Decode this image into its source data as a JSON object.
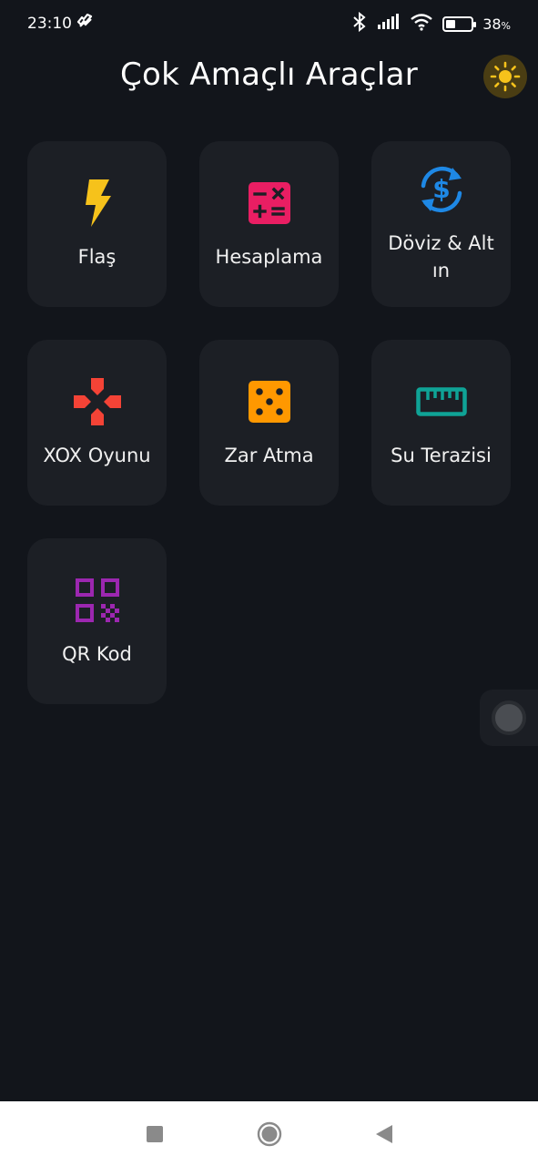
{
  "status_bar": {
    "time": "23:10",
    "battery_percent": "38",
    "battery_percent_suffix": "%",
    "battery_level": 0.38,
    "icons": [
      "notification-icon",
      "bluetooth-icon",
      "signal-icon",
      "wifi-icon",
      "battery-icon"
    ]
  },
  "header": {
    "title": "Çok Amaçlı Araçlar",
    "theme_toggle_icon": "sun-icon"
  },
  "tools": [
    {
      "label": "Flaş",
      "icon": "flash-icon",
      "color": "#f6c21b"
    },
    {
      "label": "Hesaplama",
      "icon": "calculator-icon",
      "color": "#e91e63"
    },
    {
      "label": "Döviz & Altın",
      "icon": "currency-exchange-icon",
      "color": "#1e88e5"
    },
    {
      "label": "XOX Oyunu",
      "icon": "gamepad-icon",
      "color": "#f44336"
    },
    {
      "label": "Zar Atma",
      "icon": "dice-icon",
      "color": "#ff9800"
    },
    {
      "label": "Su Terazisi",
      "icon": "ruler-icon",
      "color": "#0fa396"
    },
    {
      "label": "QR Kod",
      "icon": "qr-code-icon",
      "color": "#9c27b0"
    }
  ],
  "nav_bar": {
    "icons": [
      "recent-apps-icon",
      "home-icon",
      "back-icon"
    ]
  },
  "colors": {
    "background": "#12151b",
    "card": "#1c1f25",
    "theme_toggle_bg": "#4a3d13",
    "sun": "#f6c21b"
  }
}
